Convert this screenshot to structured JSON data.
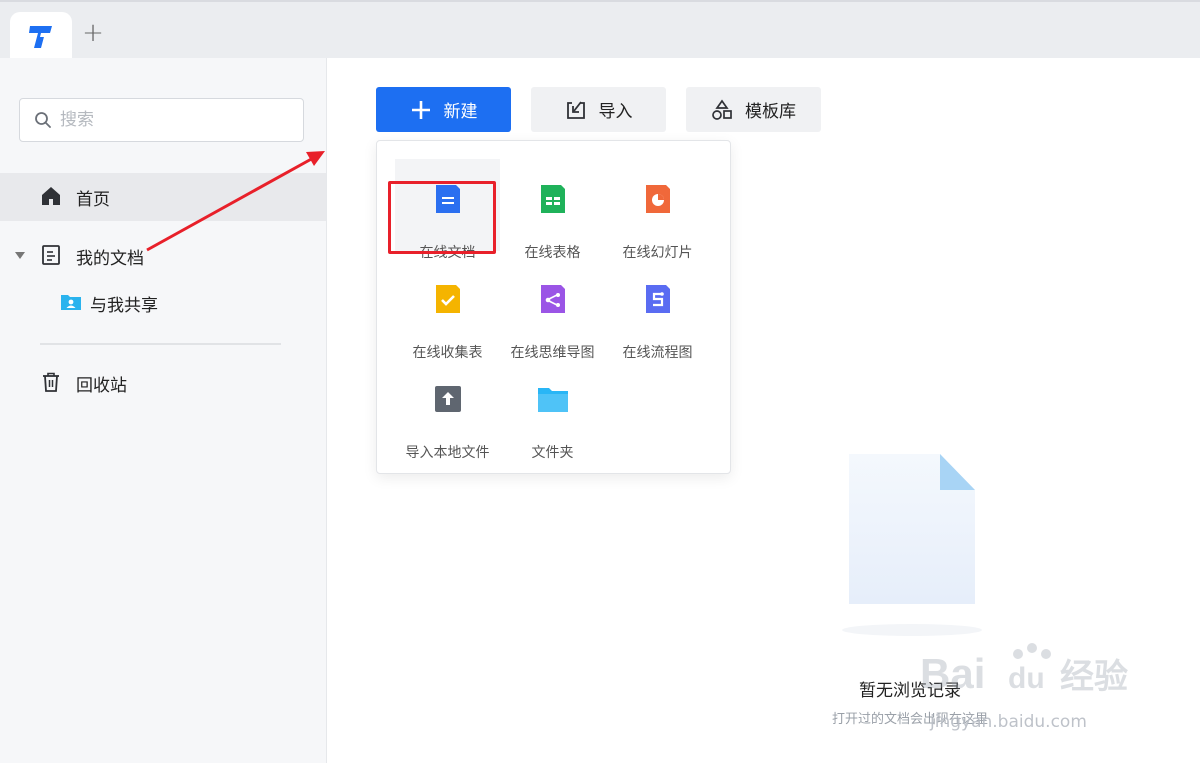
{
  "tabbar": {
    "add_tab_label": "+"
  },
  "sidebar": {
    "search_placeholder": "搜索",
    "items": [
      {
        "label": "首页",
        "icon": "home-icon"
      },
      {
        "label": "我的文档",
        "icon": "document-icon"
      },
      {
        "label": "与我共享",
        "icon": "shared-folder-icon"
      },
      {
        "label": "回收站",
        "icon": "trash-icon"
      }
    ]
  },
  "toolbar": {
    "new_label": "新建",
    "import_label": "导入",
    "template_label": "模板库"
  },
  "new_menu": {
    "items": [
      {
        "label": "在线文档",
        "icon": "online-doc-icon",
        "color": "#2b6ff0"
      },
      {
        "label": "在线表格",
        "icon": "online-sheet-icon",
        "color": "#1fb25a"
      },
      {
        "label": "在线幻灯片",
        "icon": "online-slides-icon",
        "color": "#f0683a"
      },
      {
        "label": "在线收集表",
        "icon": "online-form-icon",
        "color": "#f5b400"
      },
      {
        "label": "在线思维导图",
        "icon": "online-mindmap-icon",
        "color": "#9b55e6"
      },
      {
        "label": "在线流程图",
        "icon": "online-flowchart-icon",
        "color": "#5a6cf2"
      },
      {
        "label": "导入本地文件",
        "icon": "upload-icon",
        "color": "#5f6670"
      },
      {
        "label": "文件夹",
        "icon": "folder-icon",
        "color": "#29b6f6"
      }
    ]
  },
  "empty_state": {
    "title": "暂无浏览记录",
    "subtitle": "打开过的文档会出现在这里"
  },
  "watermark": {
    "text": "jingyan.baidu.com"
  },
  "colors": {
    "accent": "#1d6ff2",
    "annotation_red": "#e8202a"
  }
}
